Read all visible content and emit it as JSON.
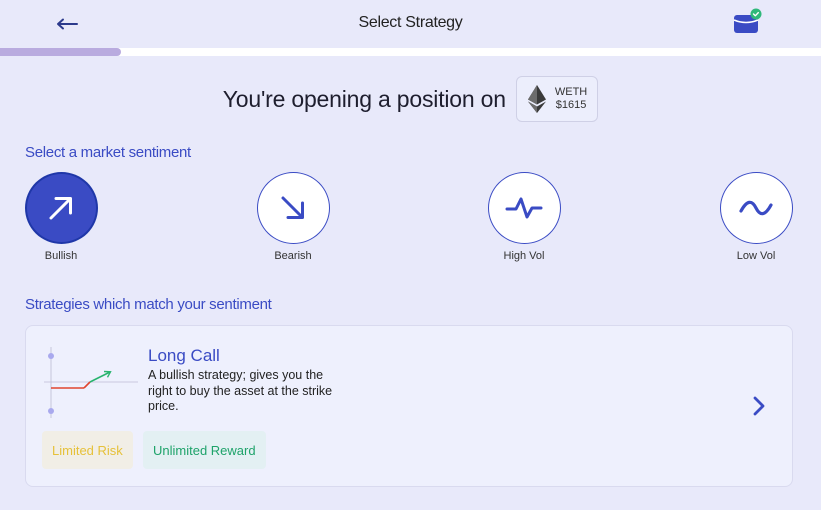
{
  "header": {
    "title": "Select Strategy"
  },
  "progress": {
    "fraction": 0.147
  },
  "opening": {
    "text": "You're opening a position on",
    "asset_symbol": "WETH",
    "asset_price": "$1615"
  },
  "sentiment_section": {
    "title": "Select a market sentiment",
    "options": [
      {
        "label": "Bullish",
        "icon": "arrow-up-right-icon",
        "selected": true
      },
      {
        "label": "Bearish",
        "icon": "arrow-down-right-icon",
        "selected": false
      },
      {
        "label": "High Vol",
        "icon": "pulse-icon",
        "selected": false
      },
      {
        "label": "Low Vol",
        "icon": "wave-icon",
        "selected": false
      }
    ]
  },
  "strategies_section": {
    "title": "Strategies which match your sentiment",
    "items": [
      {
        "name": "Long Call",
        "description": "A bullish strategy; gives you the right to buy the asset at the strike price.",
        "tags": [
          "Limited Risk",
          "Unlimited Reward"
        ]
      }
    ]
  },
  "colors": {
    "accent": "#3a4bc4",
    "background": "#e8e9fa",
    "risk": "#e6c13a",
    "reward": "#1ea36a",
    "wallet_badge": "#2fb87a"
  }
}
